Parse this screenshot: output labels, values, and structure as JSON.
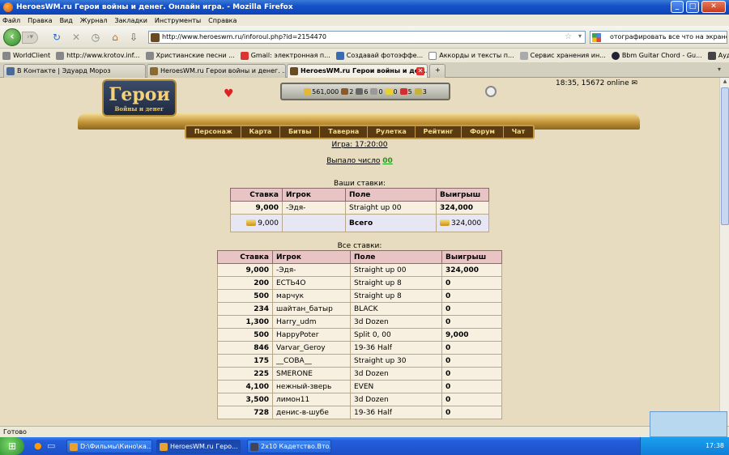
{
  "window": {
    "title": "HeroesWM.ru Герои войны и денег. Онлайн игра. - Mozilla Firefox"
  },
  "menu": [
    "Файл",
    "Правка",
    "Вид",
    "Журнал",
    "Закладки",
    "Инструменты",
    "Справка"
  ],
  "address": {
    "url": "http://www.heroeswm.ru/inforoul.php?id=2154470"
  },
  "search": {
    "value": "отографировать все что на экране"
  },
  "bookmarks": [
    "WorldClient",
    "http://www.krotov.inf...",
    "Христианские песни ...",
    "Gmail: электронная п...",
    "Создавай фотоэффе...",
    "Аккорды и тексты п...",
    "Сервис хранения ин...",
    "Bbm Guitar Chord - Gu...",
    "Аудиобиблия / Библ..."
  ],
  "tabs": [
    {
      "label": "В Контакте | Эдуард Мороз"
    },
    {
      "label": "HeroesWM.ru Герои войны и денег. ..."
    },
    {
      "label": "HeroesWM.ru Герои войны и ден..."
    }
  ],
  "game": {
    "logo": "Герои",
    "logo_sub": "Войны и денег",
    "online": "18:35, 15672 online",
    "resources": [
      "561,000",
      "2",
      "6",
      "0",
      "0",
      "5",
      "3"
    ],
    "nav": [
      "Персонаж",
      "Карта",
      "Битвы",
      "Таверна",
      "Рулетка",
      "Рейтинг",
      "Форум",
      "Чат"
    ]
  },
  "roulette": {
    "game_label": "Игра: 17:20:00",
    "result_label": "Выпало число",
    "result_value": "00",
    "my_bets_title": "Ваши ставки:",
    "all_bets_title": "Все ставки:",
    "headers": {
      "bet": "Ставка",
      "player": "Игрок",
      "field": "Поле",
      "win": "Выигрыш"
    },
    "my_bets": [
      {
        "bet": "9,000",
        "player": "-Эдя-",
        "field": "Straight up 00",
        "win": "324,000"
      }
    ],
    "my_total": {
      "bet": "9,000",
      "label": "Всего",
      "win": "324,000"
    },
    "all_bets": [
      {
        "bet": "9,000",
        "player": "-Эдя-",
        "field": "Straight up 00",
        "win": "324,000"
      },
      {
        "bet": "200",
        "player": "ЕСТЬ4О",
        "field": "Straight up 8",
        "win": "0"
      },
      {
        "bet": "500",
        "player": "марчук",
        "field": "Straight up 8",
        "win": "0"
      },
      {
        "bet": "234",
        "player": "шайтан_батыр",
        "field": "BLACK",
        "win": "0"
      },
      {
        "bet": "1,300",
        "player": "Harry_udm",
        "field": "3d Dozen",
        "win": "0"
      },
      {
        "bet": "500",
        "player": "HappyPoter",
        "field": "Split 0, 00",
        "win": "9,000"
      },
      {
        "bet": "846",
        "player": "Varvar_Geroy",
        "field": "19-36 Half",
        "win": "0"
      },
      {
        "bet": "175",
        "player": "__СОВА__",
        "field": "Straight up 30",
        "win": "0"
      },
      {
        "bet": "225",
        "player": "SMERONE",
        "field": "3d Dozen",
        "win": "0"
      },
      {
        "bet": "4,100",
        "player": "нежный-зверь",
        "field": "EVEN",
        "win": "0"
      },
      {
        "bet": "3,500",
        "player": "лимон11",
        "field": "3d Dozen",
        "win": "0"
      },
      {
        "bet": "728",
        "player": "денис-в-шубе",
        "field": "19-36 Half",
        "win": "0"
      }
    ]
  },
  "status": {
    "text": "Готово"
  },
  "taskbar": {
    "items": [
      "D:\\Фильмы\\Кино\\ка...",
      "HeroesWM.ru Геро...",
      "2x10 Кадетство.Вто..."
    ],
    "clock": "17:38"
  }
}
